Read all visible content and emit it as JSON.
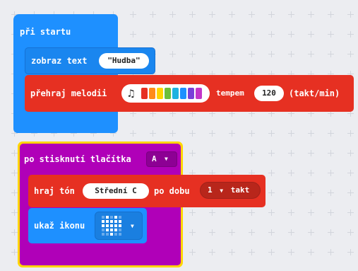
{
  "colors": {
    "background": "#ecedf1",
    "basic_blue": "#1e90ff",
    "music_red": "#e63022",
    "input_magenta": "#b000b8",
    "selection_yellow": "#ffd500"
  },
  "on_start": {
    "label": "při startu",
    "show_string": {
      "label": "zobraz text",
      "value": "\"Hudba\""
    },
    "play_melody": {
      "label": "přehraj melodii",
      "tempo_label": "tempem",
      "tempo_value": "120",
      "unit_label": "(takt/min)",
      "melody_colors": [
        "#e63022",
        "#ff8c1a",
        "#ffd500",
        "#6bbf3a",
        "#1fb2e0",
        "#1e90ff",
        "#7a3fd8",
        "#c335c9"
      ]
    }
  },
  "on_button": {
    "label": "po stisknutí tlačítka",
    "button_value": "A",
    "play_tone": {
      "label": "hraj tón",
      "note_value": "Střední C",
      "duration_label": "po dobu",
      "beat_value": "1",
      "beat_unit": "takt"
    },
    "show_icon": {
      "label": "ukaž ikonu",
      "icon_name": "heart-icon"
    }
  }
}
